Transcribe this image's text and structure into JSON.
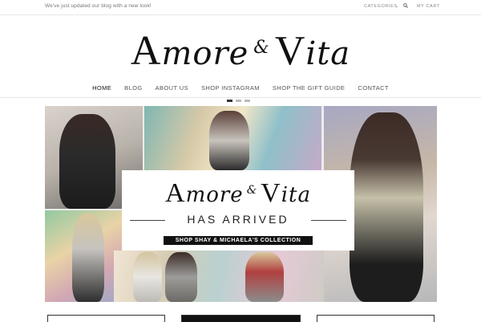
{
  "topbar": {
    "notice": "We've just updated our blog with a new look!",
    "categories": "CATEGORIES",
    "categories_chevron": "⌄",
    "cart": "MY CART",
    "search_icon": "search-icon"
  },
  "logo": {
    "a_big": "A",
    "a_rest": "more",
    "amp": "&",
    "v_big": "V",
    "v_rest": "ita"
  },
  "nav": {
    "items": [
      "HOME",
      "BLOG",
      "ABOUT US",
      "SHOP INSTAGRAM",
      "SHOP THE GIFT GUIDE",
      "CONTACT"
    ],
    "active": "HOME"
  },
  "slider": {
    "dots": 3,
    "active_dot": 0
  },
  "banner": {
    "a_big": "A",
    "a_rest": "more",
    "amp": "&",
    "v_big": "V",
    "v_rest": "ita",
    "subtitle": "HAS ARRIVED",
    "cta": "SHOP SHAY & MICHAELA'S COLLECTION"
  }
}
